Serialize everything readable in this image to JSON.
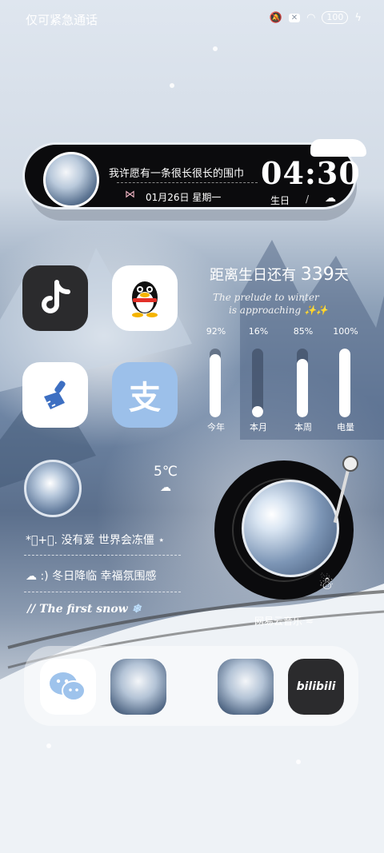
{
  "status_bar": {
    "carrier": "仅可紧急通话",
    "icons": [
      "mute-icon",
      "no-sim-icon",
      "wifi-icon"
    ],
    "battery": "100"
  },
  "top_widget": {
    "quote": "我许愿有一条很长很长的围巾",
    "date": "01月26日  星期一",
    "time": "04:30",
    "birthday_label": "生日",
    "slash": "/"
  },
  "apps": [
    {
      "name": "TikTok",
      "icon": "tiktok-icon"
    },
    {
      "name": "QQ",
      "icon": "qq-penguin-icon"
    },
    {
      "name": "Cleaner",
      "icon": "broom-icon"
    },
    {
      "name": "Alipay",
      "icon": "alipay-icon",
      "glyph": "支"
    }
  ],
  "countdown": {
    "title_prefix": "距离生日还有",
    "days": "339",
    "title_suffix": "天",
    "prelude_line1": "The prelude to winter",
    "prelude_line2": "is approaching",
    "progress": [
      {
        "label": "今年",
        "percent_text": "92%",
        "value": 0.92
      },
      {
        "label": "本月",
        "percent_text": "16%",
        "value": 0.16
      },
      {
        "label": "本周",
        "percent_text": "85%",
        "value": 0.85
      },
      {
        "label": "电量",
        "percent_text": "100%",
        "value": 1.0
      }
    ]
  },
  "weather_widget": {
    "temperature": "5℃",
    "lines": [
      "没有爱 世界会冻僵",
      ":) 冬日降临 幸福氛围感"
    ],
    "prefix1": "*ﾟ+ﾟ.",
    "english": "// The first snow"
  },
  "music_widget": {
    "label": "网易云音乐"
  },
  "dock": {
    "apps": [
      {
        "name": "WeChat",
        "icon": "wechat-icon"
      },
      {
        "name": "Photo 1",
        "icon": "snow-photo"
      },
      {
        "name": "Photo 2",
        "icon": "snow-photo"
      },
      {
        "name": "Bilibili",
        "icon": "bilibili-icon",
        "glyph": "bilibili"
      }
    ]
  }
}
